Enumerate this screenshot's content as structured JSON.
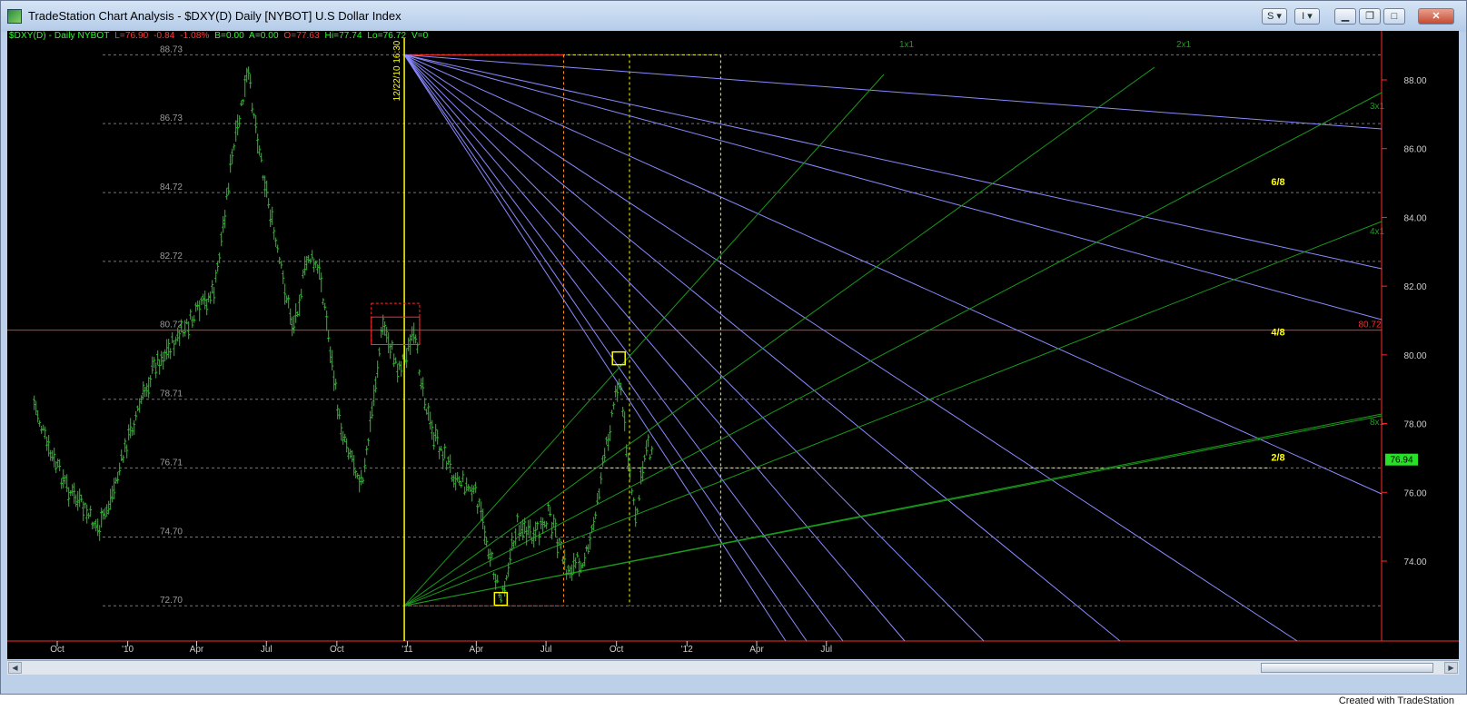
{
  "window": {
    "title": "TradeStation Chart Analysis - $DXY(D) Daily [NYBOT] U.S Dollar Index",
    "btn_s": "S",
    "btn_i": "I"
  },
  "status": {
    "symbol": "$DXY(D) - Daily  NYBOT",
    "last": "L=76.90",
    "change": "-0.84",
    "pct": "-1.08%",
    "b": "B=0.00",
    "a": "A=0.00",
    "open": "O=77.63",
    "hi": "Hi=77.74",
    "lo": "Lo=76.72",
    "vol": "V=0"
  },
  "footer": "Created with TradeStation",
  "colors": {
    "bars": "#19c919",
    "fan_blue": "#8a8aff",
    "fan_green": "#1a9a1a",
    "yellow": "#ffff00",
    "red": "#ff2a2a",
    "orange": "#ff9020"
  },
  "chart_data": {
    "type": "bar",
    "title": "$DXY(D) Daily [NYBOT] U.S Dollar Index",
    "x_tick_labels": [
      "Oct",
      "'10",
      "Apr",
      "Jul",
      "Oct",
      "'11",
      "Apr",
      "Jul",
      "Oct",
      "'12",
      "Apr",
      "Jul"
    ],
    "y_axis_labels": [
      "88.00",
      "86.00",
      "84.00",
      "82.00",
      "80.00",
      "78.00",
      "76.00",
      "74.00"
    ],
    "ylim": [
      72.0,
      89.5
    ],
    "price_levels": [
      {
        "label": "88.73",
        "value": 88.73
      },
      {
        "label": "86.73",
        "value": 86.73
      },
      {
        "label": "84.72",
        "value": 84.72
      },
      {
        "label": "82.72",
        "value": 82.72
      },
      {
        "label": "80.72",
        "value": 80.72
      },
      {
        "label": "78.71",
        "value": 78.71
      },
      {
        "label": "76.71",
        "value": 76.71
      },
      {
        "label": "74.70",
        "value": 74.7
      },
      {
        "label": "72.70",
        "value": 72.7
      }
    ],
    "murrey_labels": [
      {
        "label": "6/8",
        "value": 84.72
      },
      {
        "label": "4/8",
        "value": 80.72
      },
      {
        "label": "2/8",
        "value": 76.71
      }
    ],
    "last_price_marker": "76.94",
    "level_marker": "80.72",
    "vertical_marker_label": "12/22/10 16:30",
    "gann_labels": [
      "1x1",
      "2x1",
      "3x1",
      "4x1",
      "8x1"
    ],
    "price_path": [
      {
        "date": "2009-09-01",
        "price": 78.6
      },
      {
        "date": "2009-09-20",
        "price": 77.2
      },
      {
        "date": "2009-10-15",
        "price": 76.1
      },
      {
        "date": "2009-11-05",
        "price": 75.5
      },
      {
        "date": "2009-11-25",
        "price": 74.9
      },
      {
        "date": "2009-12-10",
        "price": 75.8
      },
      {
        "date": "2010-01-05",
        "price": 77.8
      },
      {
        "date": "2010-02-05",
        "price": 79.7
      },
      {
        "date": "2010-03-05",
        "price": 80.4
      },
      {
        "date": "2010-04-05",
        "price": 81.3
      },
      {
        "date": "2010-04-25",
        "price": 81.9
      },
      {
        "date": "2010-05-15",
        "price": 85.4
      },
      {
        "date": "2010-06-07",
        "price": 88.2
      },
      {
        "date": "2010-06-25",
        "price": 85.6
      },
      {
        "date": "2010-07-15",
        "price": 83.0
      },
      {
        "date": "2010-08-05",
        "price": 80.8
      },
      {
        "date": "2010-08-25",
        "price": 82.9
      },
      {
        "date": "2010-09-10",
        "price": 82.3
      },
      {
        "date": "2010-10-05",
        "price": 78.0
      },
      {
        "date": "2010-11-04",
        "price": 76.2
      },
      {
        "date": "2010-11-30",
        "price": 80.9
      },
      {
        "date": "2010-12-20",
        "price": 79.6
      },
      {
        "date": "2011-01-10",
        "price": 80.5
      },
      {
        "date": "2011-02-01",
        "price": 77.8
      },
      {
        "date": "2011-03-01",
        "price": 76.6
      },
      {
        "date": "2011-04-01",
        "price": 75.9
      },
      {
        "date": "2011-05-03",
        "price": 72.9
      },
      {
        "date": "2011-05-25",
        "price": 75.1
      },
      {
        "date": "2011-06-15",
        "price": 74.6
      },
      {
        "date": "2011-07-05",
        "price": 75.4
      },
      {
        "date": "2011-07-28",
        "price": 73.7
      },
      {
        "date": "2011-08-25",
        "price": 74.2
      },
      {
        "date": "2011-09-20",
        "price": 77.6
      },
      {
        "date": "2011-10-04",
        "price": 79.4
      },
      {
        "date": "2011-10-26",
        "price": 75.1
      },
      {
        "date": "2011-11-10",
        "price": 77.6
      },
      {
        "date": "2011-11-18",
        "price": 76.9
      }
    ]
  }
}
